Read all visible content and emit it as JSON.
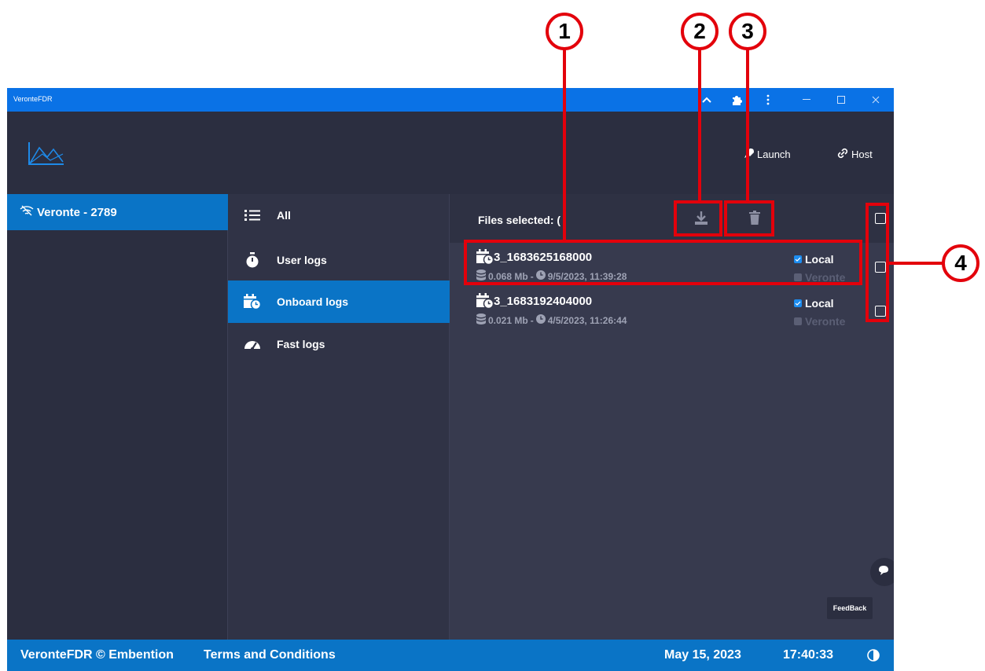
{
  "window": {
    "title": "VeronteFDR",
    "controls": [
      "chevron-up-icon",
      "puzzle-icon",
      "kebab-menu-icon",
      "minimize-icon",
      "maximize-icon",
      "close-icon"
    ]
  },
  "header": {
    "launch_label": "Launch",
    "host_label": "Host"
  },
  "devices": [
    {
      "label": "Veronte - 2789",
      "icon": "wifi-off-icon"
    }
  ],
  "nav": {
    "items": [
      {
        "label": "All",
        "icon": "list-icon"
      },
      {
        "label": "User logs",
        "icon": "stopwatch-icon"
      },
      {
        "label": "Onboard logs",
        "icon": "calendar-clock-icon"
      },
      {
        "label": "Fast logs",
        "icon": "speedometer-icon"
      }
    ]
  },
  "files": {
    "selected_label": "Files selected: (",
    "rows": [
      {
        "name": "3_1683625168000",
        "size": "0.068 Mb",
        "sep": "-",
        "date": "9/5/2023, 11:39:28",
        "local": "Local",
        "veronte": "Veronte"
      },
      {
        "name": "3_1683192404000",
        "size": "0.021 Mb",
        "sep": "-",
        "date": "4/5/2023, 11:26:44",
        "local": "Local",
        "veronte": "Veronte"
      }
    ]
  },
  "feedback_label": "FeedBack",
  "footer": {
    "brand": "VeronteFDR © Embention",
    "terms": "Terms and Conditions",
    "date": "May 15, 2023",
    "time": "17:40:33"
  },
  "callouts": {
    "one": "1",
    "two": "2",
    "three": "3",
    "four": "4"
  },
  "colors": {
    "accent": "#0a74c6",
    "titlebar": "#0a72e6",
    "annotation": "#e3000b"
  }
}
